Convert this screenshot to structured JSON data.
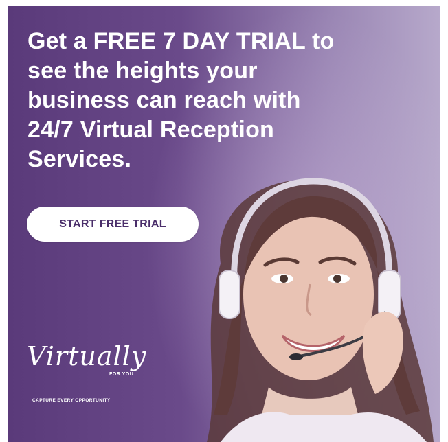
{
  "ad": {
    "headline": "Get a FREE 7 DAY TRIAL to\nsee the heights your\nbusiness can reach with\n24/7 Virtual Reception\nServices.",
    "cta_label": "START FREE TRIAL",
    "logo": {
      "wordmark": "Virtually",
      "subtitle": "FOR YOU",
      "tagline": "CAPTURE EVERY OPPORTUNITY"
    }
  },
  "colors": {
    "background_left": "#5a3a7a",
    "background_right": "#b7a9cb",
    "button_bg": "#ffffff",
    "button_text": "#4a2e6a",
    "text": "#ffffff"
  },
  "image": {
    "subject": "smiling woman wearing headset"
  }
}
